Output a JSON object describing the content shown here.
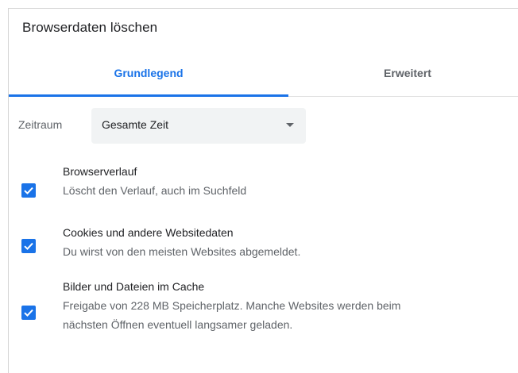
{
  "dialog": {
    "title": "Browserdaten löschen"
  },
  "tabs": [
    {
      "label": "Grundlegend",
      "active": true
    },
    {
      "label": "Erweitert",
      "active": false
    }
  ],
  "time_range": {
    "label": "Zeitraum",
    "value": "Gesamte Zeit"
  },
  "options": [
    {
      "title": "Browserverlauf",
      "description_lines": [
        "Löscht den Verlauf, auch im Suchfeld"
      ],
      "checked": true
    },
    {
      "title": "Cookies und andere Websitedaten",
      "description_lines": [
        "Du wirst von den meisten Websites abgemeldet."
      ],
      "checked": true
    },
    {
      "title": "Bilder und Dateien im Cache",
      "description_lines": [
        "Freigabe von 228 MB Speicherplatz. Manche Websites werden beim",
        "nächsten Öffnen eventuell langsamer geladen."
      ],
      "checked": true
    }
  ],
  "colors": {
    "accent": "#1a73e8",
    "text_primary": "#202124",
    "text_secondary": "#5f6368",
    "select_bg": "#f1f3f4"
  }
}
